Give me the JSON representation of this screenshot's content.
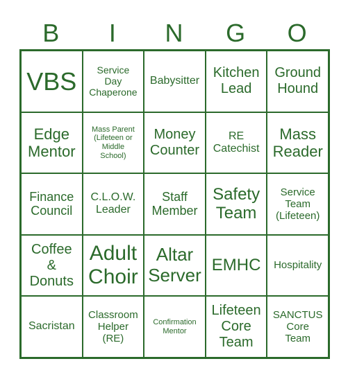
{
  "header": [
    "B",
    "I",
    "N",
    "G",
    "O"
  ],
  "color": "#2b6a2b",
  "cells": [
    "VBS",
    "Service\nDay\nChaperone",
    "Babysitter",
    "Kitchen\nLead",
    "Ground\nHound",
    "Edge\nMentor",
    "Mass Parent\n(Lifeteen or\nMiddle\nSchool)",
    "Money\nCounter",
    "RE\nCatechist",
    "Mass\nReader",
    "Finance\nCouncil",
    "C.L.O.W.\nLeader",
    "Staff\nMember",
    "Safety\nTeam",
    "Service\nTeam\n(Lifeteen)",
    "Coffee\n&\nDonuts",
    "Adult\nChoir",
    "Altar\nServer",
    "EMHC",
    "Hospitality",
    "Sacristan",
    "Classroom\nHelper\n(RE)",
    "Confirmation\nMentor",
    "Lifeteen\nCore\nTeam",
    "SANCTUS\nCore\nTeam"
  ]
}
